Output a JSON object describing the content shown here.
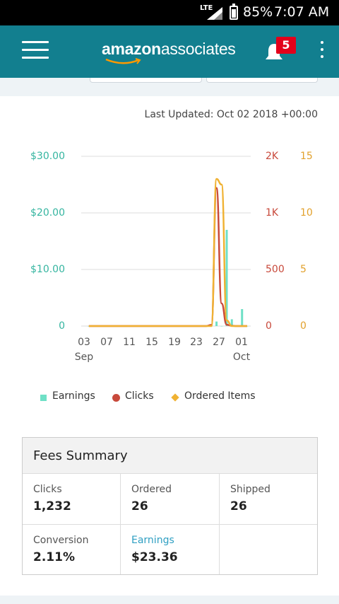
{
  "status_bar": {
    "network": "LTE",
    "battery": "85%",
    "time": "7:07 AM"
  },
  "app_bar": {
    "logo_amazon": "amazon",
    "logo_associates": "associates",
    "notification_count": "5",
    "accent": "#127f8f"
  },
  "report": {
    "last_updated": "Last Updated: Oct 02 2018 +00:00"
  },
  "chart_data": {
    "type": "line",
    "x_ticks": [
      "03",
      "07",
      "11",
      "15",
      "19",
      "23",
      "27",
      "01"
    ],
    "x_months": [
      "Sep",
      "Oct"
    ],
    "y_left_ticks": [
      "$30.00",
      "$20.00",
      "$10.00",
      "0"
    ],
    "y_right1_ticks": [
      "2K",
      "1K",
      "500",
      "0"
    ],
    "y_right2_ticks": [
      "15",
      "10",
      "5",
      "0"
    ],
    "y_left_range": [
      0,
      30
    ],
    "y_right1_range": [
      0,
      1500
    ],
    "y_right2_range": [
      0,
      15
    ],
    "grid": true,
    "legend_position": "bottom",
    "colors": {
      "earnings": "#6fe0c6",
      "clicks": "#c8493b",
      "ordered": "#f0b233"
    },
    "x": [
      "Sep 1",
      "Sep 2",
      "Sep 3",
      "Sep 4",
      "Sep 5",
      "Sep 6",
      "Sep 7",
      "Sep 8",
      "Sep 9",
      "Sep 10",
      "Sep 11",
      "Sep 12",
      "Sep 13",
      "Sep 14",
      "Sep 15",
      "Sep 16",
      "Sep 17",
      "Sep 18",
      "Sep 19",
      "Sep 20",
      "Sep 21",
      "Sep 22",
      "Sep 23",
      "Sep 24",
      "Sep 25",
      "Sep 26",
      "Sep 27",
      "Sep 28",
      "Sep 29",
      "Sep 30",
      "Oct 1",
      "Oct 2"
    ],
    "series": [
      {
        "name": "Earnings",
        "kind": "bar",
        "values": [
          0,
          0,
          0,
          0,
          0,
          0,
          0,
          0,
          0,
          0,
          0,
          0,
          0,
          0,
          0,
          0,
          0,
          0,
          0,
          0,
          0,
          0,
          0,
          0,
          0,
          0.8,
          0,
          17,
          1.2,
          0,
          3,
          0
        ]
      },
      {
        "name": "Clicks",
        "kind": "line",
        "values": [
          0,
          0,
          0,
          0,
          0,
          0,
          0,
          0,
          0,
          0,
          0,
          0,
          0,
          0,
          0,
          0,
          0,
          0,
          0,
          0,
          0,
          0,
          0,
          0,
          10,
          1220,
          200,
          12,
          2,
          0,
          0,
          0
        ]
      },
      {
        "name": "Ordered Items",
        "kind": "line",
        "values": [
          0,
          0,
          0,
          0,
          0,
          0,
          0,
          0,
          0,
          0,
          0,
          0,
          0,
          0,
          0,
          0,
          0,
          0,
          0,
          0,
          0,
          0,
          0,
          0,
          0,
          13,
          12.5,
          0.5,
          0,
          0,
          0,
          0
        ]
      }
    ]
  },
  "fees_summary": {
    "title": "Fees Summary",
    "clicks_label": "Clicks",
    "clicks_value": "1,232",
    "ordered_label": "Ordered",
    "ordered_value": "26",
    "shipped_label": "Shipped",
    "shipped_value": "26",
    "conversion_label": "Conversion",
    "conversion_value": "2.11%",
    "earnings_label": "Earnings",
    "earnings_value": "$23.36"
  }
}
